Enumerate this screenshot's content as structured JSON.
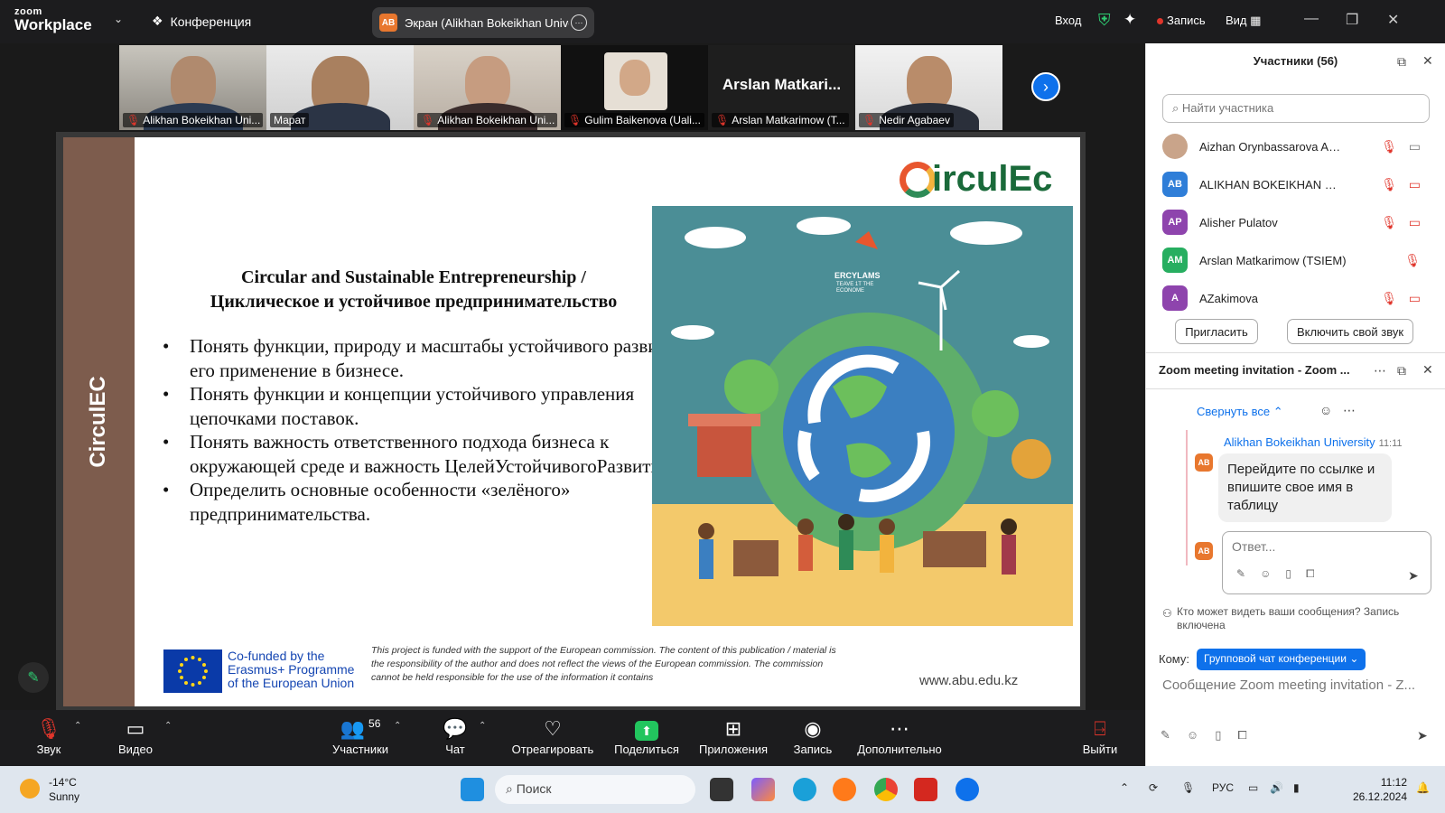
{
  "topbar": {
    "logo_small": "zoom",
    "logo_big": "Workplace",
    "conference": "Конференция",
    "share_badge": "AB",
    "share_title": "Экран (Alikhan Bokeikhan Universit",
    "login": "Вход",
    "record": "Запись",
    "view": "Вид"
  },
  "thumbnails": [
    {
      "name": "Alikhan Bokeikhan Uni...",
      "muted": true
    },
    {
      "name": "Марат",
      "muted": false
    },
    {
      "name": "Alikhan Bokeikhan Uni...",
      "muted": true
    },
    {
      "name": "Gulim Baikenova (Uali...",
      "muted": true
    },
    {
      "name": "Arslan Matkarimow (T...",
      "muted": true,
      "big_name": "Arslan  Matkari..."
    },
    {
      "name": "Nedir Agabaev",
      "muted": true
    }
  ],
  "slide": {
    "side_text": "CirculEC",
    "logo": "irculEc",
    "title_line1": "Circular and Sustainable Entrepreneurship /",
    "title_line2": "Циклическое и устойчивое предпринимательство",
    "bullets": [
      "Понять функции, природу и масштабы устойчивого развития и его применение в бизнесе.",
      "Понять функции и концепции устойчивого управления цепочками поставок.",
      "Понять важность ответственного подхода бизнеса к окружающей среде и важность ЦелейУстойчивогоРазвития.",
      "Определить основные особенности «зелёного» предпринимательства."
    ],
    "illus_caption": "ERCYLAMS",
    "illus_sub": "TEAVE 1T THE ECONOME",
    "eu_line1": "Co-funded by the",
    "eu_line2": "Erasmus+ Programme",
    "eu_line3": "of the European Union",
    "disclaimer": "This project is funded with the support of the European commission. The content of this publication / material is the responsibility of the author and does not reflect the views of the European commission. The commission cannot be held responsible for the use of the information it contains",
    "website": "www.abu.edu.kz"
  },
  "toolbar": {
    "audio": "Звук",
    "video": "Видео",
    "participants": "Участники",
    "participants_count": "56",
    "chat": "Чат",
    "react": "Отреагировать",
    "share": "Поделиться",
    "apps": "Приложения",
    "record": "Запись",
    "more": "Дополнительно",
    "leave": "Выйти"
  },
  "participants_panel": {
    "title": "Участники (56)",
    "search_placeholder": "Найти участника",
    "list": [
      {
        "initials": "",
        "name": "Aizhan Orynbassarova ABU",
        "color": "#c9a48a",
        "cam_off": false
      },
      {
        "initials": "AB",
        "name": "ALIKHAN BOKEIKHAN UNIVERSI...",
        "color": "#2f7ed8",
        "cam_off": true
      },
      {
        "initials": "AP",
        "name": "Alisher Pulatov",
        "color": "#8e44ad",
        "cam_off": true
      },
      {
        "initials": "AM",
        "name": "Arslan Matkarimow (TSIEM)",
        "color": "#27ae60",
        "cam_off": false
      },
      {
        "initials": "A",
        "name": "AZakimova",
        "color": "#8e44ad",
        "cam_off": true
      }
    ],
    "invite": "Пригласить",
    "unmute": "Включить свой звук"
  },
  "chat_panel": {
    "title": "Zoom meeting invitation - Zoom ...",
    "collapse": "Свернуть все",
    "author": "Alikhan Bokeikhan University",
    "time": "11:11",
    "avatar": "AB",
    "message": "Перейдите по ссылке и впишите свое имя в таблицу",
    "reply_placeholder": "Ответ...",
    "who_can_see": "Кто может видеть ваши сообщения? Запись включена",
    "to_label": "Кому:",
    "to_value": "Групповой чат конференции",
    "compose_placeholder": "Сообщение Zoom meeting invitation - Z..."
  },
  "taskbar": {
    "temp": "-14°C",
    "weather": "Sunny",
    "search": "Поиск",
    "lang": "РУС",
    "time": "11:12",
    "date": "26.12.2024"
  }
}
